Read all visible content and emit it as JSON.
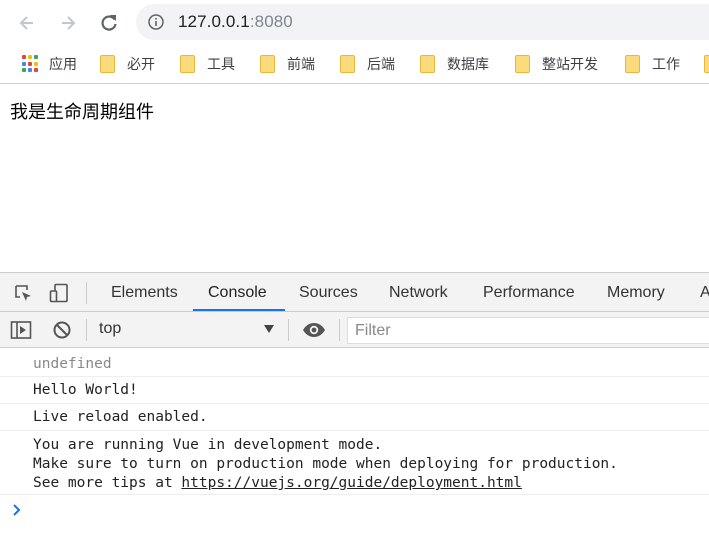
{
  "browser": {
    "url_host": "127.0.0.1",
    "url_port": ":8080"
  },
  "bookmarks": {
    "apps_label": "应用",
    "folders": [
      "必开",
      "工具",
      "前端",
      "后端",
      "数据库",
      "整站开发",
      "工作"
    ]
  },
  "page": {
    "text": "我是生命周期组件"
  },
  "devtools": {
    "tabs": [
      "Elements",
      "Console",
      "Sources",
      "Network",
      "Performance",
      "Memory",
      "A"
    ],
    "active_tab": "Console",
    "context": "top",
    "filter_placeholder": "Filter",
    "messages": [
      {
        "text": "undefined"
      },
      {
        "text": "Hello World!"
      },
      {
        "text": "Live reload enabled."
      },
      {
        "line1": "You are running Vue in development mode.",
        "line2": "Make sure to turn on production mode when deploying for production.",
        "line3_prefix": "See more tips at ",
        "line3_link": "https://vuejs.org/guide/deployment.html"
      }
    ]
  },
  "colors": {
    "accent": "#1a73e8",
    "folder": "#fddb7c",
    "console_prompt": "#1a73e8"
  }
}
